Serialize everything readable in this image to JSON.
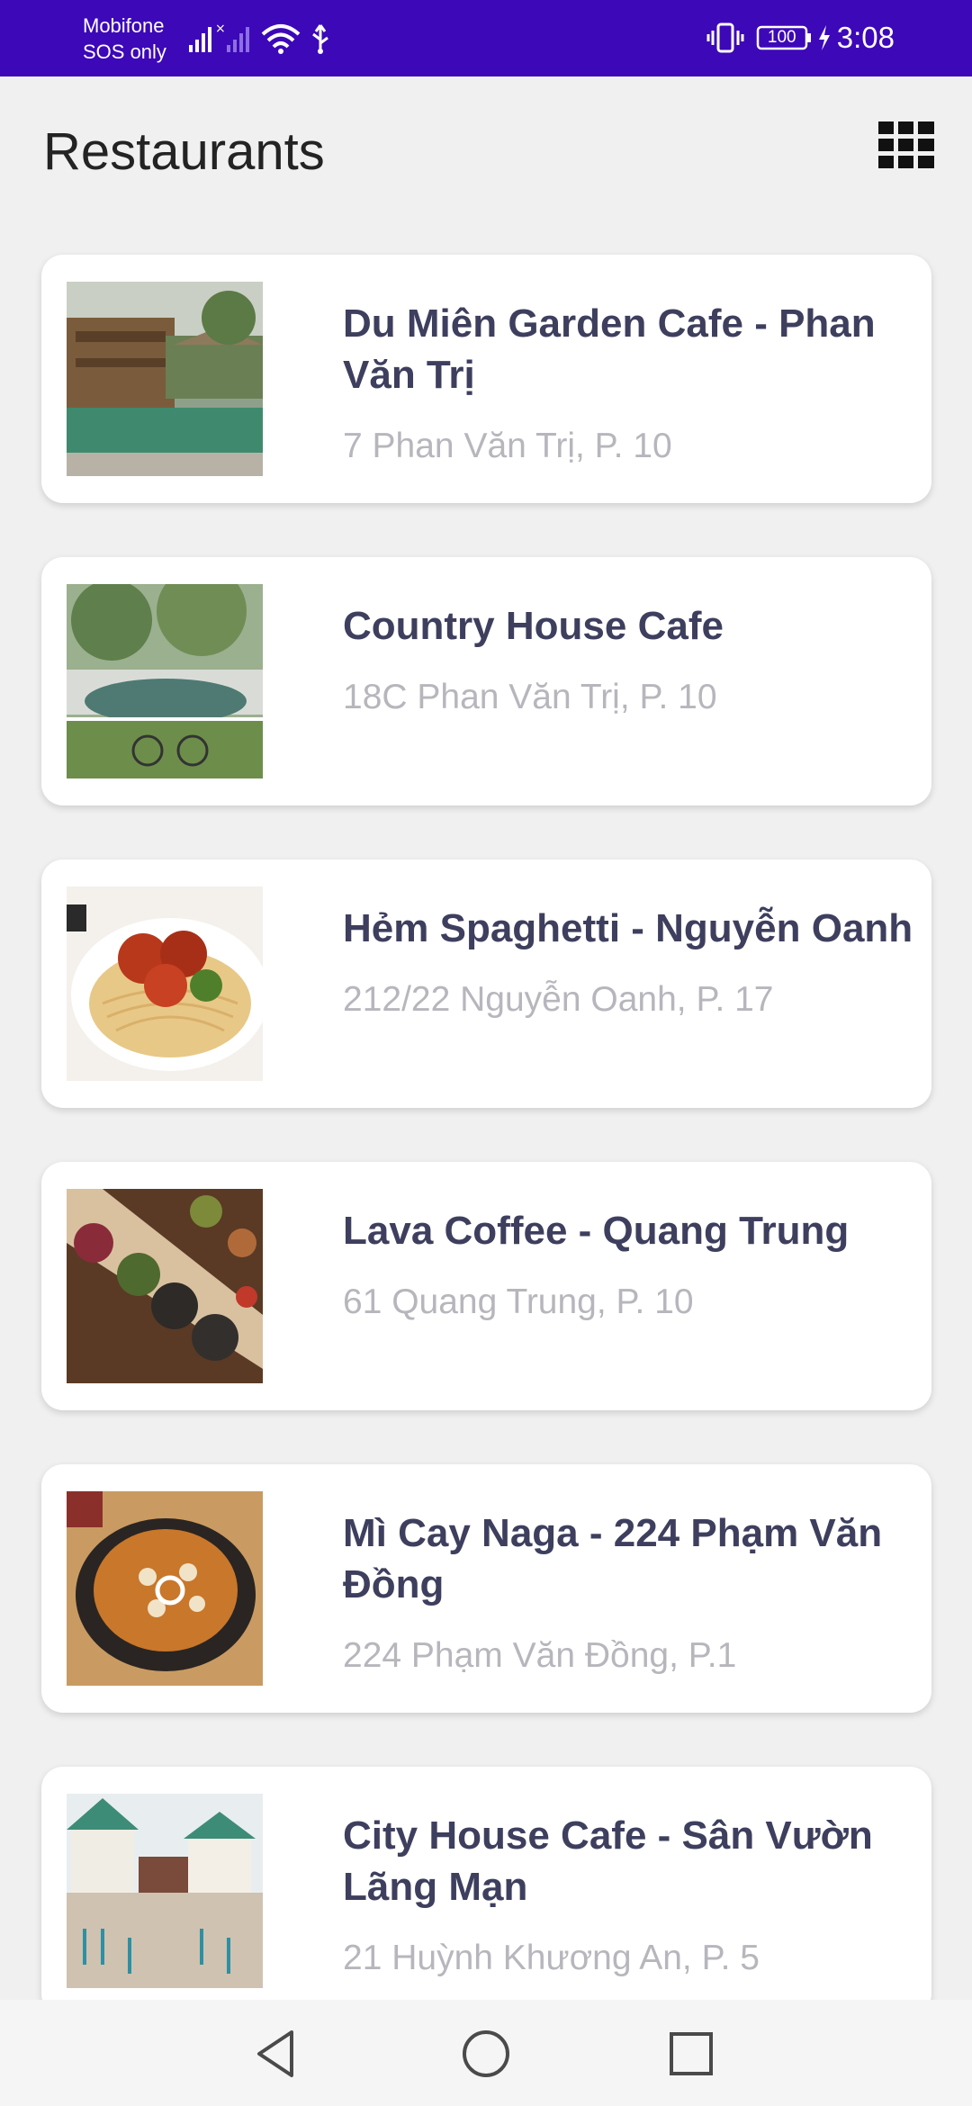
{
  "status_bar": {
    "carrier_name": "Mobifone",
    "carrier_status": "SOS only",
    "battery": "100",
    "time": "3:08",
    "background_color": "#3d08b8"
  },
  "header": {
    "title": "Restaurants",
    "view_toggle_icon": "grid-icon"
  },
  "restaurants": [
    {
      "name": "Du Miên Garden Cafe - Phan Văn Trị",
      "address": "7 Phan Văn Trị, P. 10",
      "image": "garden-cafe-photo"
    },
    {
      "name": "Country House Cafe",
      "address": "18C Phan Văn Trị, P. 10",
      "image": "country-house-photo"
    },
    {
      "name": "Hẻm Spaghetti - Nguyễn Oanh",
      "address": "212/22 Nguyễn Oanh, P. 17",
      "image": "spaghetti-photo"
    },
    {
      "name": "Lava Coffee - Quang Trung",
      "address": "61 Quang Trung, P. 10",
      "image": "lava-cake-photo"
    },
    {
      "name": "Mì Cay Naga - 224 Phạm Văn Đồng",
      "address": "224 Phạm Văn Đồng, P.1",
      "image": "spicy-noodle-photo"
    },
    {
      "name": "City House Cafe - Sân Vườn Lãng Mạn",
      "address": "21 Huỳnh Khương An, P. 5",
      "image": "city-house-photo"
    }
  ],
  "nav_bar": {
    "back_icon": "back-triangle-icon",
    "home_icon": "home-circle-icon",
    "recents_icon": "recents-square-icon"
  },
  "colors": {
    "title_text": "#3e3f5e",
    "address_text": "#b6b6bc",
    "background": "#f0f0f0"
  }
}
